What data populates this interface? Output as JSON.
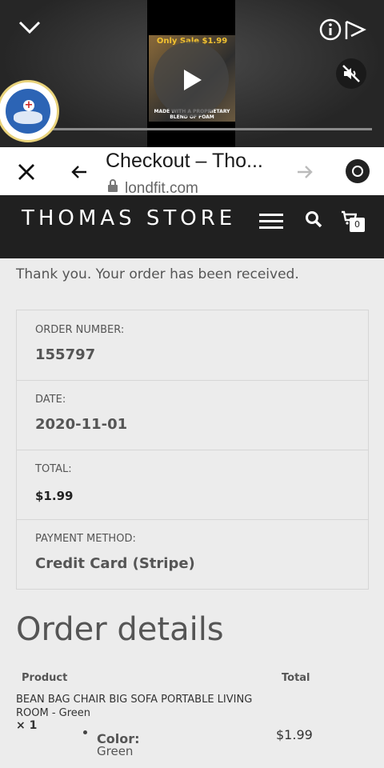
{
  "ad": {
    "top_text": "Only Sale $1.99",
    "bottom_text": "MADE WITH A PROPRIETARY BLEND OF FOAM"
  },
  "tab_bar": {
    "title": "Checkout – Tho...",
    "url": "londfit.com"
  },
  "store": {
    "name": "THOMAS STORE",
    "cart_count": "0"
  },
  "order": {
    "thanks": "Thank you. Your order has been received.",
    "overview": [
      {
        "label": "ORDER NUMBER:",
        "value": "155797"
      },
      {
        "label": "DATE:",
        "value": "2020-11-01"
      },
      {
        "label": "TOTAL:",
        "value": "$1.99"
      },
      {
        "label": "PAYMENT METHOD:",
        "value": "Credit Card (Stripe)"
      }
    ]
  },
  "details": {
    "title": "Order details",
    "col_product": "Product",
    "col_total": "Total",
    "item": {
      "name": "BEAN BAG CHAIR BIG SOFA PORTABLE LIVING ROOM - Green",
      "qty": "× 1",
      "meta_key": "Color:",
      "meta_value": "Green",
      "total": "$1.99"
    }
  }
}
